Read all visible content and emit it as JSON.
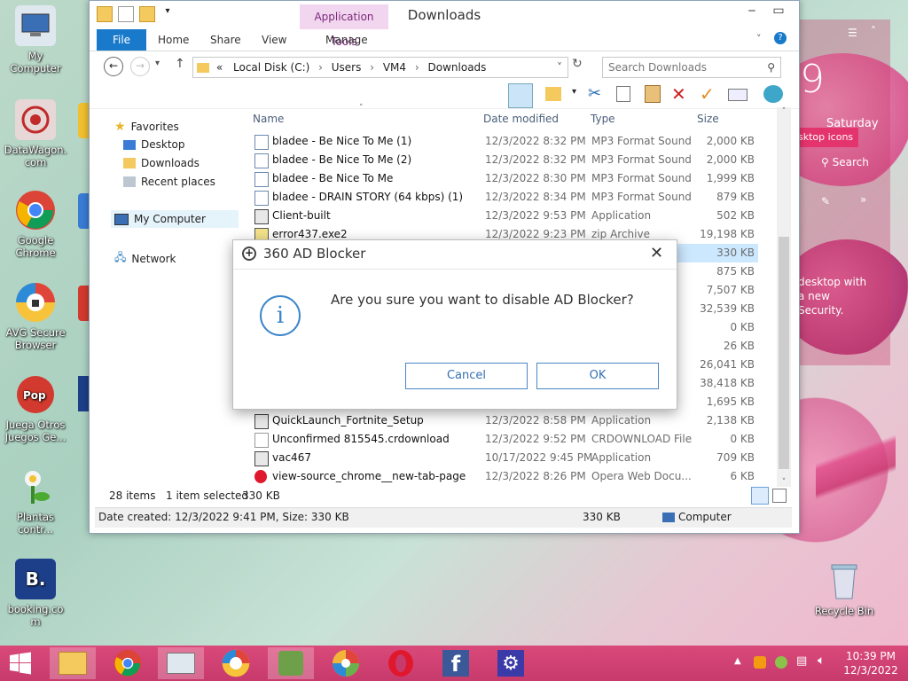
{
  "desktop": {
    "icons": [
      {
        "label": "My\nComputer",
        "name": "my-computer"
      },
      {
        "label": "DataWagon.\ncom",
        "name": "datawagon"
      },
      {
        "label": "Google\nChrome",
        "name": "google-chrome"
      },
      {
        "label": "AVG Secure\nBrowser",
        "name": "avg-secure-browser"
      },
      {
        "label": "Juega Otros\nJuegos Ge...",
        "name": "popcap-games"
      },
      {
        "label": "Plantas\ncontr...",
        "name": "plantas"
      },
      {
        "label": "booking.co\nm",
        "name": "booking"
      },
      {
        "label": "Recycle Bin",
        "name": "recycle-bin"
      }
    ],
    "partial_labels": [
      "3(",
      "S",
      "360",
      "(",
      "B",
      "fa"
    ]
  },
  "widget": {
    "time_partial": "9",
    "day": "Saturday",
    "desktop_icons_label": "sktop icons",
    "search_label": "Search",
    "text_lines": [
      " desktop with",
      "a new",
      " Security."
    ]
  },
  "window": {
    "title": "Downloads",
    "app_tools_label": "Application Tools",
    "tabs": {
      "file": "File",
      "home": "Home",
      "share": "Share",
      "view": "View",
      "manage": "Manage"
    },
    "address": {
      "prefix": "«",
      "crumbs": [
        "Local Disk (C:)",
        "Users",
        "VM4",
        "Downloads"
      ]
    },
    "search_placeholder": "Search Downloads",
    "nav": {
      "favorites": "Favorites",
      "desktop": "Desktop",
      "downloads": "Downloads",
      "recent": "Recent places",
      "my_computer": "My Computer",
      "network": "Network"
    },
    "columns": {
      "name": "Name",
      "date": "Date modified",
      "type": "Type",
      "size": "Size"
    },
    "files": [
      {
        "name": "bladee - Be Nice To Me (1)",
        "date": "12/3/2022 8:32 PM",
        "type": "MP3 Format Sound",
        "size": "2,000 KB",
        "icon": "audio-file"
      },
      {
        "name": "bladee - Be Nice To Me (2)",
        "date": "12/3/2022 8:32 PM",
        "type": "MP3 Format Sound",
        "size": "2,000 KB",
        "icon": "audio-file"
      },
      {
        "name": "bladee - Be Nice To Me",
        "date": "12/3/2022 8:30 PM",
        "type": "MP3 Format Sound",
        "size": "1,999 KB",
        "icon": "audio-file"
      },
      {
        "name": "bladee - DRAIN STORY (64 kbps) (1)",
        "date": "12/3/2022 8:34 PM",
        "type": "MP3 Format Sound",
        "size": "879 KB",
        "icon": "audio-file"
      },
      {
        "name": "Client-built",
        "date": "12/3/2022 9:53 PM",
        "type": "Application",
        "size": "502 KB",
        "icon": "app-file"
      },
      {
        "name": "error437.exe2",
        "date": "12/3/2022 9:23 PM",
        "type": "zip Archive",
        "size": "19,198 KB",
        "icon": "zip-file"
      },
      {
        "name": "",
        "date": "",
        "type": "",
        "size": "330 KB",
        "icon": "",
        "selected": true
      },
      {
        "name": "",
        "date": "",
        "type": "",
        "size": "875 KB",
        "icon": ""
      },
      {
        "name": "",
        "date": "",
        "type": "d",
        "size": "7,507 KB",
        "icon": ""
      },
      {
        "name": "",
        "date": "",
        "type": "",
        "size": "32,539 KB",
        "icon": ""
      },
      {
        "name": "",
        "date": "",
        "type": "le",
        "size": "0 KB",
        "icon": ""
      },
      {
        "name": "",
        "date": "",
        "type": "",
        "size": "26 KB",
        "icon": ""
      },
      {
        "name": "",
        "date": "",
        "type": "",
        "size": "26,041 KB",
        "icon": ""
      },
      {
        "name": "",
        "date": "",
        "type": "",
        "size": "38,418 KB",
        "icon": ""
      },
      {
        "name": "",
        "date": "",
        "type": "",
        "size": "1,695 KB",
        "icon": ""
      },
      {
        "name": "QuickLaunch_Fortnite_Setup",
        "date": "12/3/2022 8:58 PM",
        "type": "Application",
        "size": "2,138 KB",
        "icon": "app-file"
      },
      {
        "name": "Unconfirmed 815545.crdownload",
        "date": "12/3/2022 9:52 PM",
        "type": "CRDOWNLOAD File",
        "size": "0 KB",
        "icon": "blank-file"
      },
      {
        "name": "vac467",
        "date": "10/17/2022 9:45 PM",
        "type": "Application",
        "size": "709 KB",
        "icon": "app-file"
      },
      {
        "name": "view-source_chrome__new-tab-page",
        "date": "12/3/2022 8:26 PM",
        "type": "Opera Web Docu...",
        "size": "6 KB",
        "icon": "opera-file"
      }
    ],
    "status": {
      "items": "28 items",
      "selected": "1 item selected",
      "selected_size": "330 KB"
    },
    "details": {
      "text": "Date created: 12/3/2022 9:41 PM, Size: 330 KB",
      "size": "330 KB",
      "location": "Computer"
    }
  },
  "dialog": {
    "title": "360 AD Blocker",
    "message": "Are you sure you want to disable AD Blocker?",
    "cancel": "Cancel",
    "ok": "OK"
  },
  "taskbar": {
    "apps": [
      "file-explorer",
      "chrome",
      "performance-monitor",
      "avg-browser",
      "plants-game",
      "360-browser",
      "opera",
      "facebook",
      "settings"
    ],
    "time": "10:39 PM",
    "date": "12/3/2022"
  },
  "colors": {
    "accent": "#1979ca",
    "taskbar": "#c73a6c",
    "dialog_button": "#3470b3"
  }
}
